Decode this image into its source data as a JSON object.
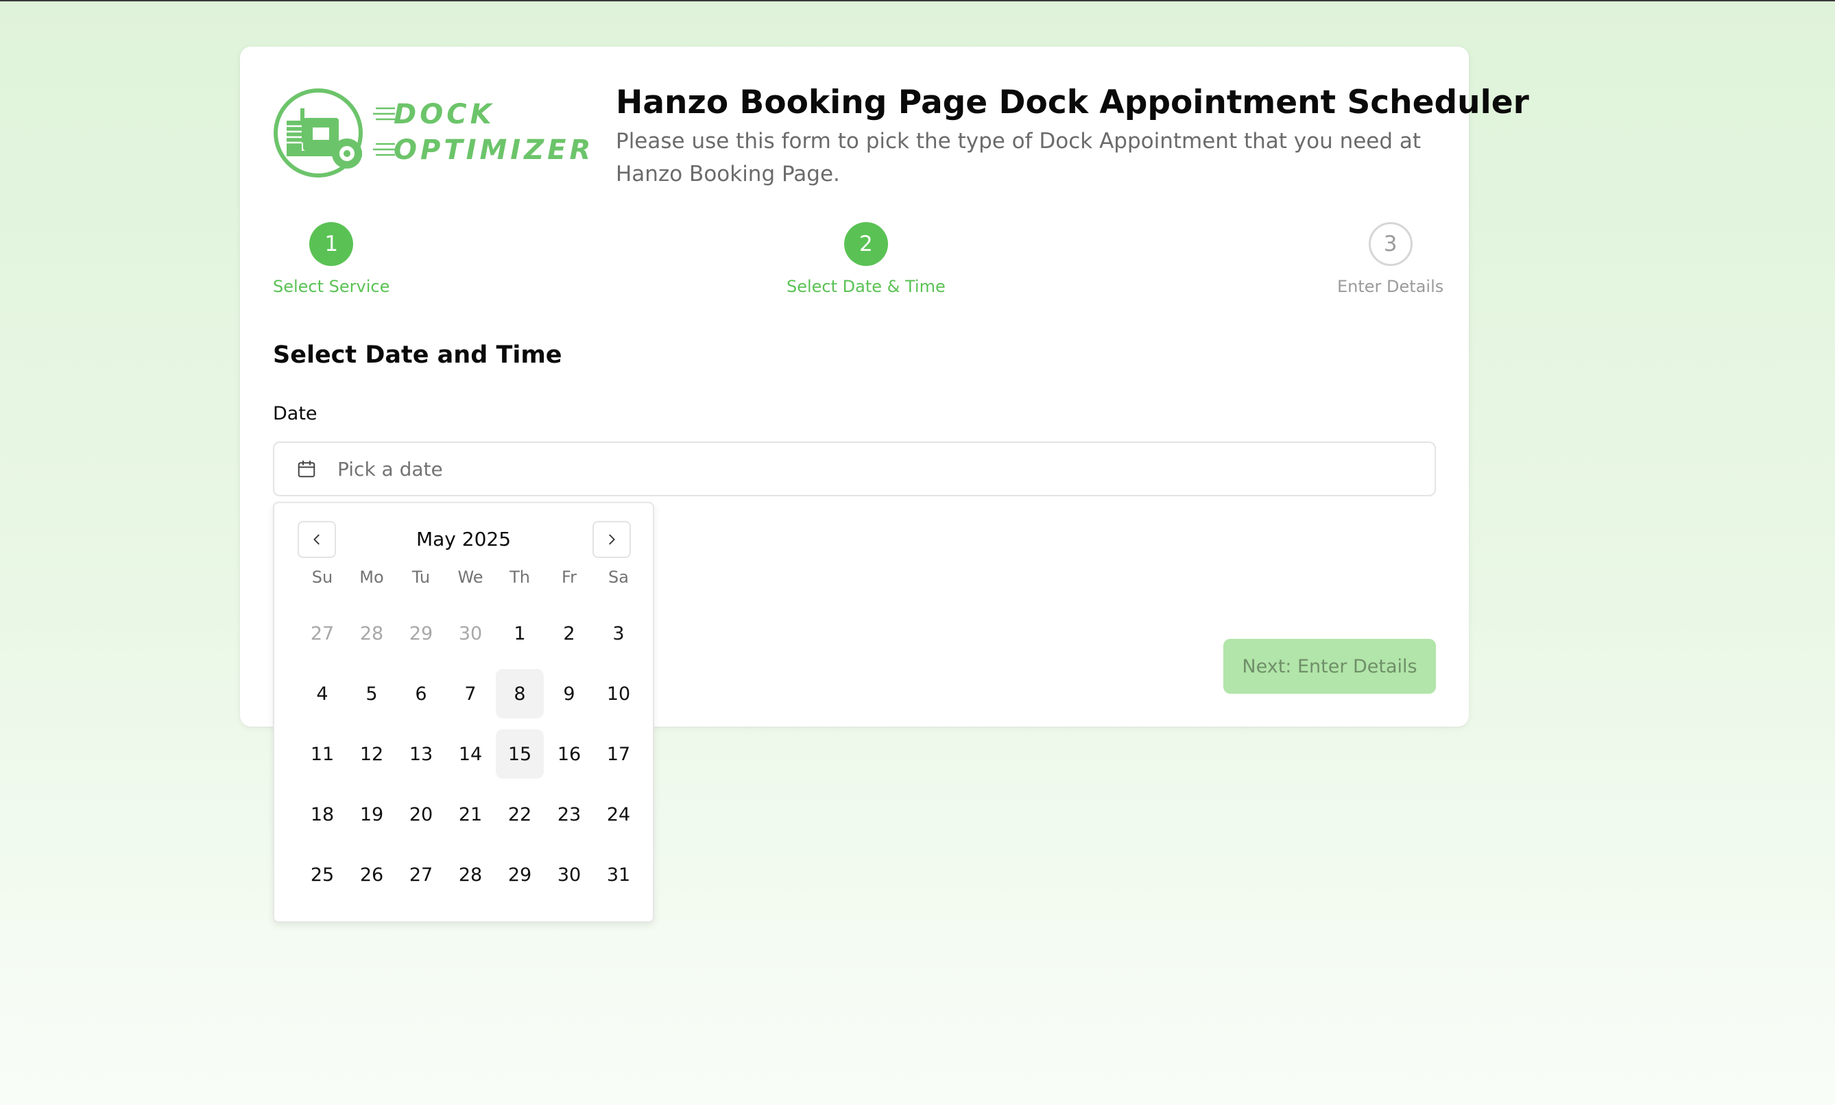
{
  "header": {
    "logo_text_line1": "DOCK",
    "logo_text_line2": "OPTIMIZER",
    "title": "Hanzo Booking Page Dock Appointment Scheduler",
    "description": "Please use this form to pick the type of Dock Appointment that you need at Hanzo Booking Page."
  },
  "steps": [
    {
      "number": "1",
      "label": "Select Service",
      "state": "complete"
    },
    {
      "number": "2",
      "label": "Select Date & Time",
      "state": "current"
    },
    {
      "number": "3",
      "label": "Enter Details",
      "state": "pending"
    }
  ],
  "form": {
    "section_title": "Select Date and Time",
    "date_label": "Date",
    "date_placeholder": "Pick a date",
    "next_button": "Next: Enter Details"
  },
  "calendar": {
    "month_label": "May 2025",
    "weekdays": [
      "Su",
      "Mo",
      "Tu",
      "We",
      "Th",
      "Fr",
      "Sa"
    ],
    "days": [
      {
        "label": "27",
        "outside": true
      },
      {
        "label": "28",
        "outside": true
      },
      {
        "label": "29",
        "outside": true
      },
      {
        "label": "30",
        "outside": true
      },
      {
        "label": "1"
      },
      {
        "label": "2"
      },
      {
        "label": "3"
      },
      {
        "label": "4"
      },
      {
        "label": "5"
      },
      {
        "label": "6"
      },
      {
        "label": "7"
      },
      {
        "label": "8",
        "highlighted": true
      },
      {
        "label": "9"
      },
      {
        "label": "10"
      },
      {
        "label": "11"
      },
      {
        "label": "12"
      },
      {
        "label": "13"
      },
      {
        "label": "14"
      },
      {
        "label": "15",
        "highlighted": true
      },
      {
        "label": "16"
      },
      {
        "label": "17"
      },
      {
        "label": "18"
      },
      {
        "label": "19"
      },
      {
        "label": "20"
      },
      {
        "label": "21"
      },
      {
        "label": "22"
      },
      {
        "label": "23"
      },
      {
        "label": "24"
      },
      {
        "label": "25"
      },
      {
        "label": "26"
      },
      {
        "label": "27"
      },
      {
        "label": "28"
      },
      {
        "label": "29"
      },
      {
        "label": "30"
      },
      {
        "label": "31"
      }
    ]
  },
  "colors": {
    "accent": "#5ac254",
    "button_disabled_bg": "#b2e5a9",
    "muted_text": "#737373"
  },
  "icons": {
    "input_icon": "calendar-icon",
    "prev": "chevron-left-icon",
    "next": "chevron-right-icon"
  }
}
